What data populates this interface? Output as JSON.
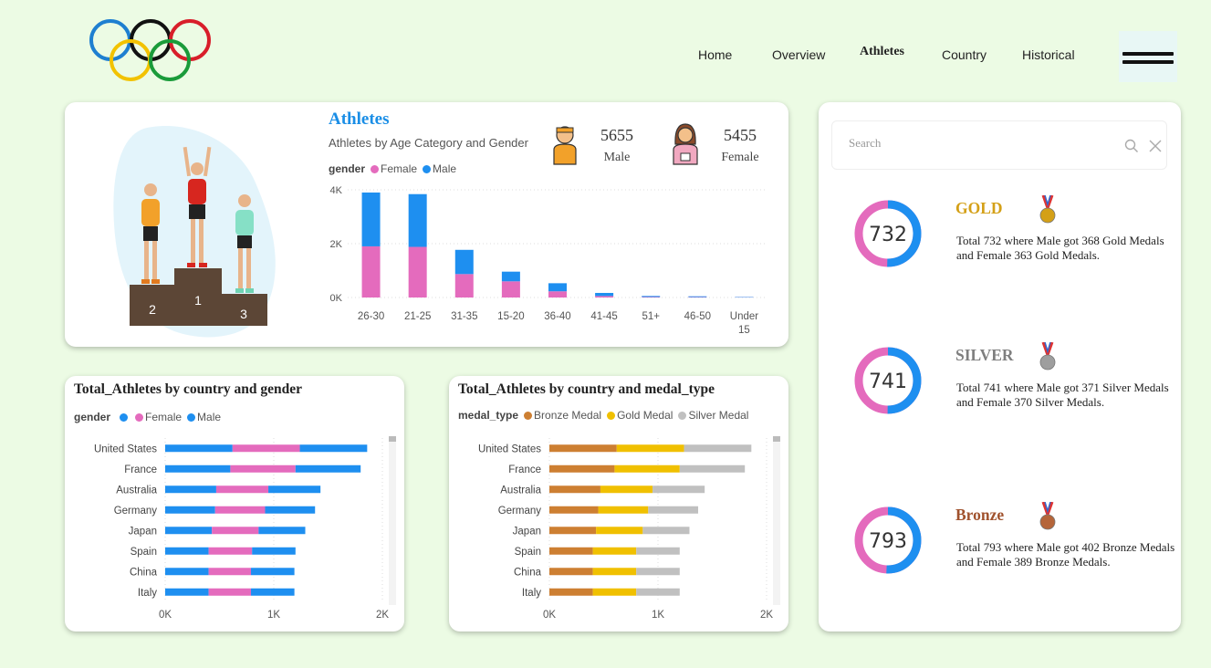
{
  "header": {
    "nav": [
      {
        "label": "Home",
        "active": false
      },
      {
        "label": "Overview",
        "active": false
      },
      {
        "label": "Athletes",
        "active": true
      },
      {
        "label": "Country",
        "active": false
      },
      {
        "label": "Historical",
        "active": false
      }
    ]
  },
  "athletes_card": {
    "title": "Athletes",
    "subtitle": "Athletes by Age Category and Gender",
    "legend_title": "gender",
    "podium_labels": [
      "2",
      "1",
      "3"
    ],
    "male": {
      "count": "5655",
      "label": "Male"
    },
    "female": {
      "count": "5455",
      "label": "Female"
    }
  },
  "country_gender_card": {
    "title": "Total_Athletes by country and gender",
    "legend_title": "gender"
  },
  "country_medal_card": {
    "title": "Total_Athletes by country and medal_type",
    "legend_title": "medal_type"
  },
  "medals_panel": {
    "search_placeholder": "Search",
    "medals": [
      {
        "name": "GOLD",
        "color": "#d4a017",
        "total": "732",
        "male_share": 0.503,
        "description": "Total 732 where Male got 368 Gold Medals and Female 363 Gold Medals."
      },
      {
        "name": "SILVER",
        "color": "#7f7f7f",
        "total": "741",
        "male_share": 0.501,
        "description": "Total 741 where Male got 371 Silver Medals and Female 370 Silver Medals."
      },
      {
        "name": "Bronze",
        "color": "#a0522d",
        "total": "793",
        "male_share": 0.507,
        "description": "Total 793 where Male got 402 Bronze Medals and Female 389 Bronze Medals."
      }
    ]
  },
  "colors": {
    "female": "#e46bbd",
    "male": "#1e8ff0",
    "bronze": "#cd7f32",
    "gold": "#f0c000",
    "silver": "#c0c0c0"
  },
  "chart_data": [
    {
      "type": "bar",
      "stacked": true,
      "categories": [
        "26-30",
        "21-25",
        "31-35",
        "15-20",
        "36-40",
        "41-45",
        "51+",
        "46-50",
        "Under 15"
      ],
      "series": [
        {
          "name": "Female",
          "values": [
            1900,
            1880,
            870,
            600,
            230,
            55,
            18,
            14,
            8
          ]
        },
        {
          "name": "Male",
          "values": [
            2000,
            1960,
            900,
            360,
            300,
            115,
            38,
            30,
            14
          ]
        }
      ],
      "ylim": [
        0,
        4000
      ],
      "yticks": [
        "0K",
        "2K",
        "4K"
      ],
      "legend": "top-left",
      "grid": true
    },
    {
      "type": "bar",
      "orientation": "horizontal",
      "stacked": true,
      "categories": [
        "United States",
        "France",
        "Australia",
        "Germany",
        "Japan",
        "Spain",
        "China",
        "Italy"
      ],
      "legend_entries": [
        "",
        "Female",
        "Male"
      ],
      "series": [
        {
          "name": "",
          "values": [
            620,
            600,
            470,
            460,
            430,
            400,
            400,
            400
          ]
        },
        {
          "name": "Female",
          "values": [
            620,
            600,
            480,
            460,
            430,
            400,
            390,
            390
          ]
        },
        {
          "name": "Male",
          "values": [
            620,
            600,
            480,
            460,
            430,
            400,
            400,
            400
          ]
        }
      ],
      "xlim": [
        0,
        2000
      ],
      "xticks": [
        "0K",
        "1K",
        "2K"
      ],
      "legend": "top-left",
      "grid": true
    },
    {
      "type": "bar",
      "orientation": "horizontal",
      "stacked": true,
      "categories": [
        "United States",
        "France",
        "Australia",
        "Germany",
        "Japan",
        "Spain",
        "China",
        "Italy"
      ],
      "series": [
        {
          "name": "Bronze Medal",
          "values": [
            620,
            600,
            470,
            450,
            430,
            400,
            400,
            400
          ]
        },
        {
          "name": "Gold Medal",
          "values": [
            620,
            600,
            480,
            460,
            430,
            400,
            400,
            400
          ]
        },
        {
          "name": "Silver Medal",
          "values": [
            620,
            600,
            480,
            460,
            430,
            400,
            400,
            400
          ]
        }
      ],
      "xlim": [
        0,
        2000
      ],
      "xticks": [
        "0K",
        "1K",
        "2K"
      ],
      "legend": "top-left",
      "grid": true
    }
  ]
}
